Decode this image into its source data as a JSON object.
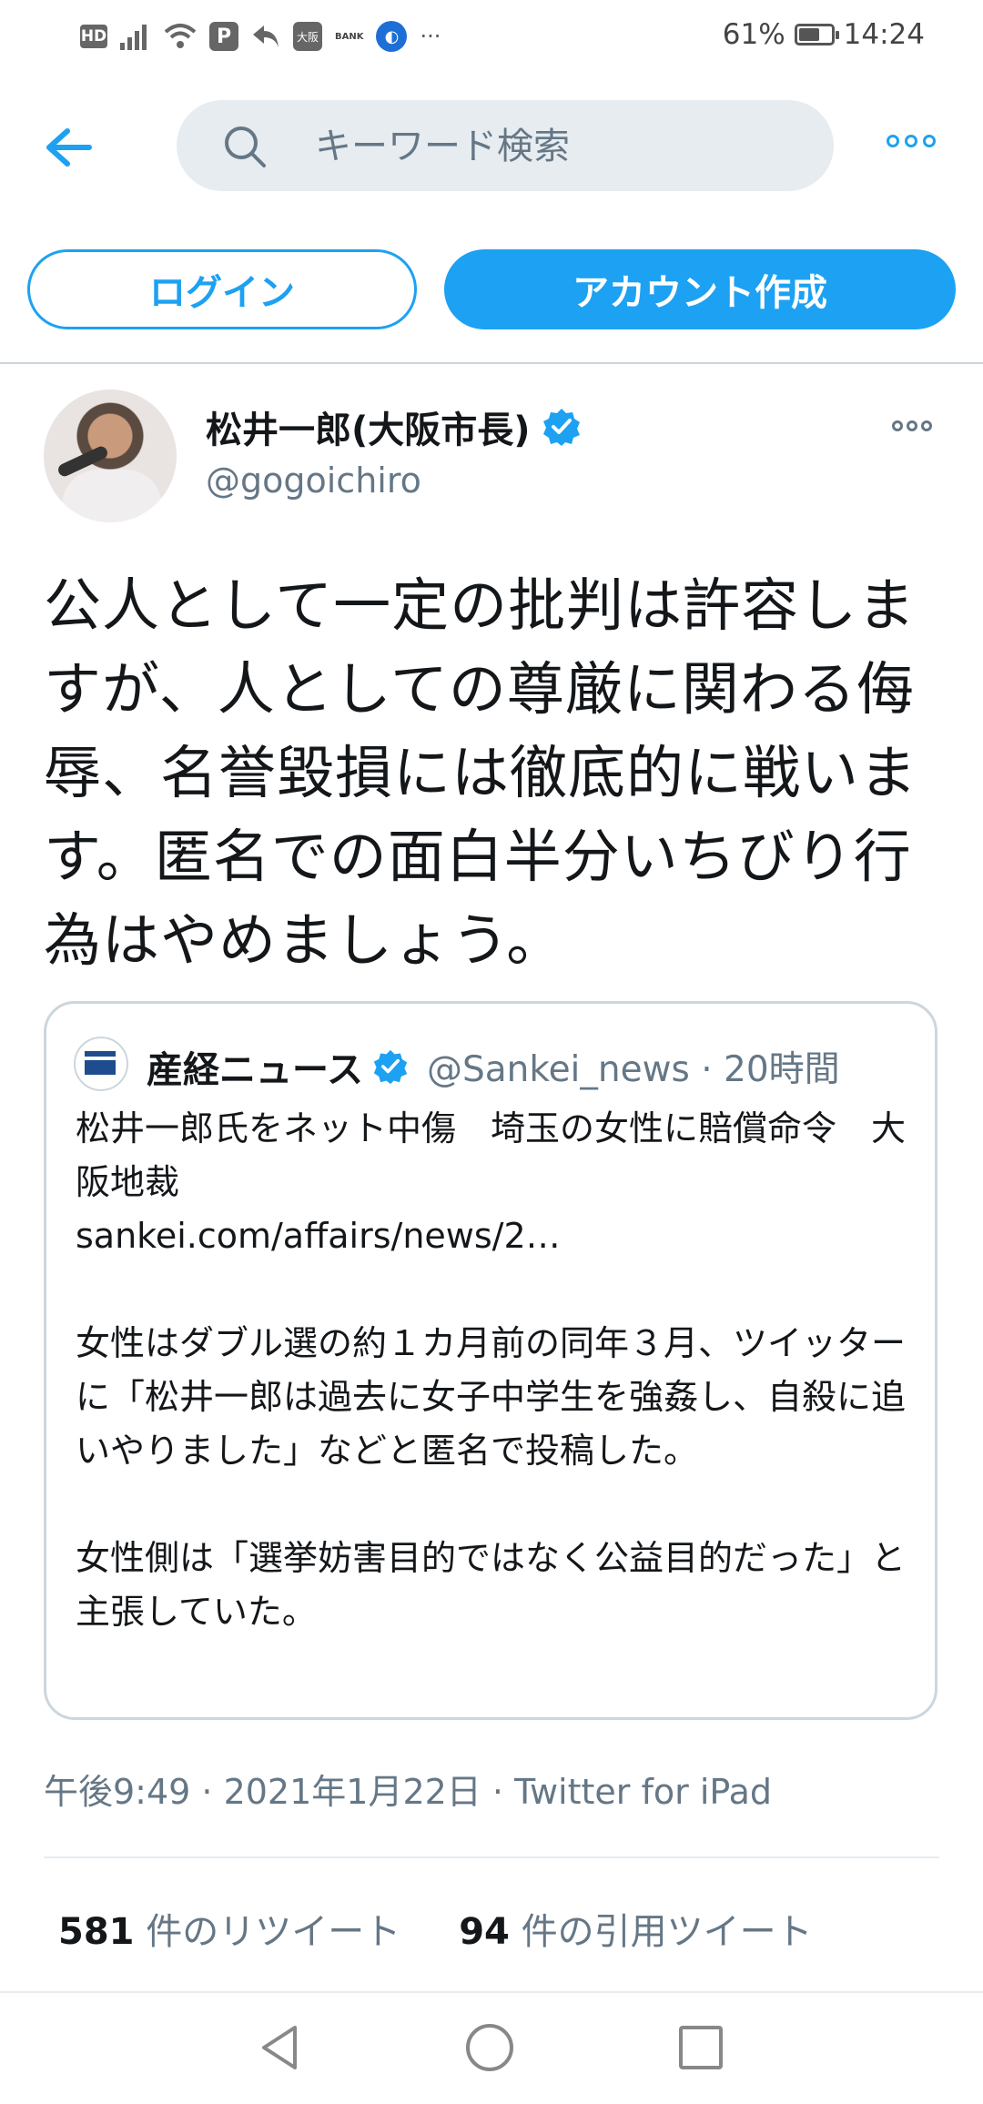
{
  "status_bar": {
    "left_icons": [
      "hd-icon",
      "signal-icon",
      "wifi-icon",
      "p-app-icon",
      "arrow-icon",
      "app-icon",
      "bank-icon",
      "browser-icon",
      "more-notifications-icon"
    ],
    "hd_label": "HD",
    "p_label": "P",
    "app_label": "大阪",
    "bank_label": "BANK",
    "overflow": "···",
    "battery": "61%",
    "time": "14:24"
  },
  "header": {
    "search_placeholder": "キーワード検索"
  },
  "auth": {
    "login_label": "ログイン",
    "signup_label": "アカウント作成"
  },
  "tweet": {
    "author_name": "松井一郎(大阪市長)",
    "author_handle": "@gogoichiro",
    "text": "公人として一定の批判は許容しますが、人としての尊厳に関わる侮辱、名誉毀損には徹底的に戦います。匿名での面白半分いちびり行為はやめましょう。",
    "meta": "午後9:49 · 2021年1月22日 · Twitter for iPad"
  },
  "quote": {
    "name": "産経ニュース",
    "handle": "@Sankei_news · 20時間",
    "text": "松井一郎氏をネット中傷　埼玉の女性に賠償命令　大阪地裁\nsankei.com/affairs/news/2…\n\n女性はダブル選の約１カ月前の同年３月、ツイッターに「松井一郎は過去に女子中学生を強姦し、自殺に追いやりました」などと匿名で投稿した。\n\n女性側は「選挙妨害目的ではなく公益目的だった」と主張していた。"
  },
  "stats": {
    "retweets_count": "581",
    "retweets_label": "件のリツイート",
    "quotes_count": "94",
    "quotes_label": "件の引用ツイート"
  },
  "colors": {
    "accent": "#1da1f2",
    "muted": "#657786",
    "text": "#14171a",
    "border": "#ccd6dd"
  }
}
